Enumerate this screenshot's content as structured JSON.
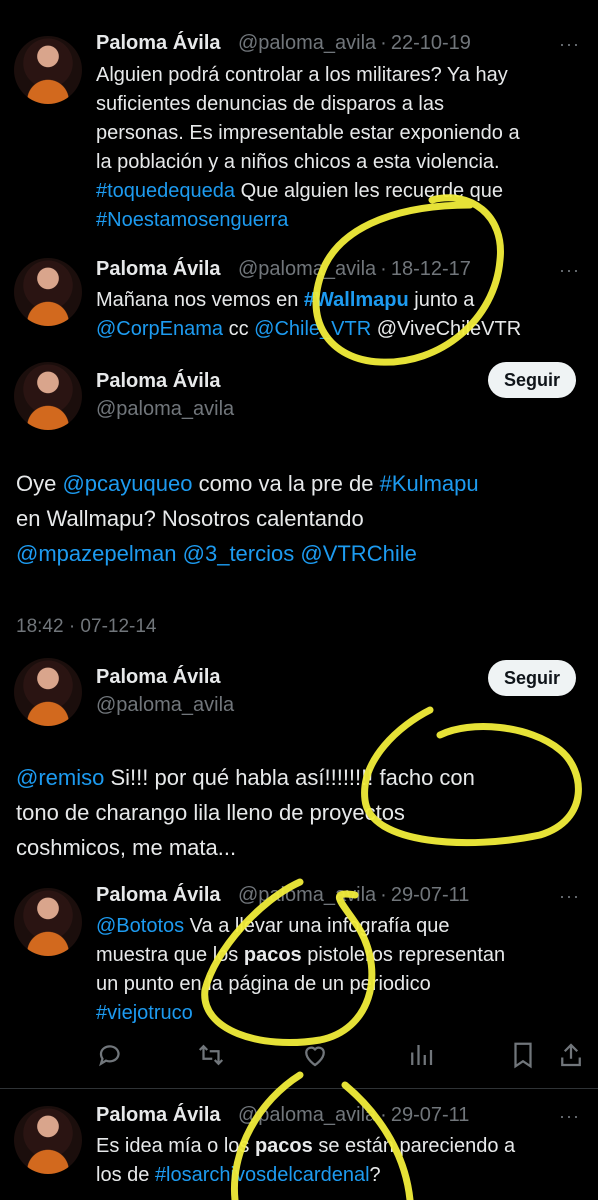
{
  "user": {
    "name": "Paloma Ávila",
    "handle": "@paloma_avila",
    "handle_truncated": "@paloma_avila"
  },
  "follow_label": "Seguir",
  "more_label": "···",
  "tweet1": {
    "date": "22-10-19",
    "lines": [
      "Alguien podrá controlar a los militares? Ya hay",
      "suficientes denuncias de disparos a las",
      "personas. Es impresentable estar exponiendo a",
      "la población y a niños chicos a esta violencia."
    ],
    "hashtag1": "#toquedequeda",
    "text_after_hashtag1": " Que alguien les recuerde que",
    "hashtag2": "#Noestamosenguerra"
  },
  "tweet2": {
    "date": "18-12-17",
    "text1": "Mañana nos vemos en ",
    "hashtag": "#Wallmapu",
    "text2": " junto a",
    "mention1": "@CorpEnama",
    "cc": " cc ",
    "mention2": "@Chile_VTR",
    "mention3": " @ViveChileVTR"
  },
  "tweet3": {
    "t1": "Oye ",
    "mention1": "@pcayuqueo",
    "t2": " como va la pre de ",
    "hashtag": "#Kulmapu",
    "t3": "en Wallmapu? Nosotros calentando",
    "mention2": "@mpazepelman",
    "mention3": " @3_tercios",
    "mention4": " @VTRChile",
    "timestamp": "18:42 · 07-12-14"
  },
  "tweet4": {
    "mention": "@remiso",
    "t1": " Si!!! por qué habla así!!!!!!!! facho con",
    "t2": "tono de charango lila lleno de proyectos",
    "t3": "coshmicos, me mata..."
  },
  "tweet5": {
    "date": "29-07-11",
    "mention": "@Bototos",
    "t1": " Va a llevar una infografía que",
    "t2a": "muestra que los ",
    "bold": "pacos",
    "t2b": " pistoleros representan",
    "t3": "un punto en la página de un periodico",
    "hashtag": "#viejotruco"
  },
  "tweet6": {
    "date": "29-07-11",
    "t1a": "Es idea mía o los ",
    "bold": "pacos",
    "t1b": " se están pareciendo a",
    "t2": "los de ",
    "hashtag": "#losarchivosdelcardenal",
    "t3": "?"
  },
  "colors": {
    "accent": "#1d9bf0",
    "muted": "#71767b",
    "highlighter": "#f2ee3a"
  }
}
